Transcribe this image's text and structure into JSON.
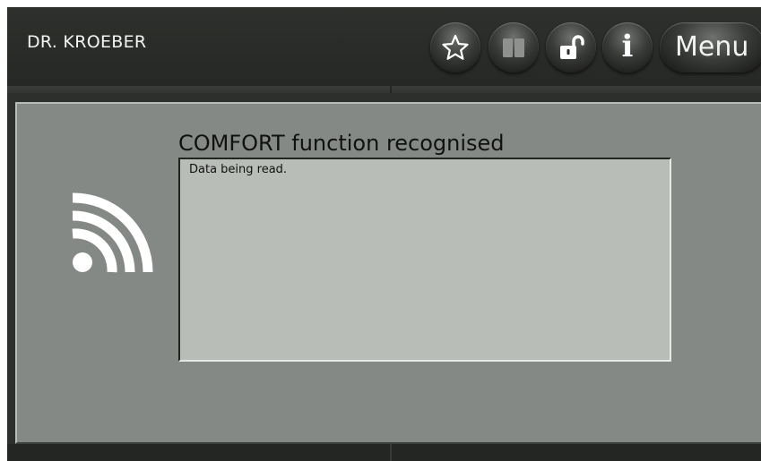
{
  "header": {
    "brand": "DR. KROEBER",
    "buttons": [
      {
        "name": "favorites",
        "icon": "star-icon"
      },
      {
        "name": "manual",
        "icon": "book-icon"
      },
      {
        "name": "lock",
        "icon": "unlock-icon"
      },
      {
        "name": "info",
        "icon": "info-icon",
        "glyph": "i"
      }
    ],
    "menu_label": "Menu"
  },
  "content": {
    "status_icon": "wireless-signal-icon",
    "title": "COMFORT function recognised",
    "message": "Data being read."
  },
  "colors": {
    "header_bg": "#2d2f2c",
    "panel_bg": "#858985",
    "message_box_bg": "#b8bdb8",
    "icon_white": "#ffffff"
  }
}
